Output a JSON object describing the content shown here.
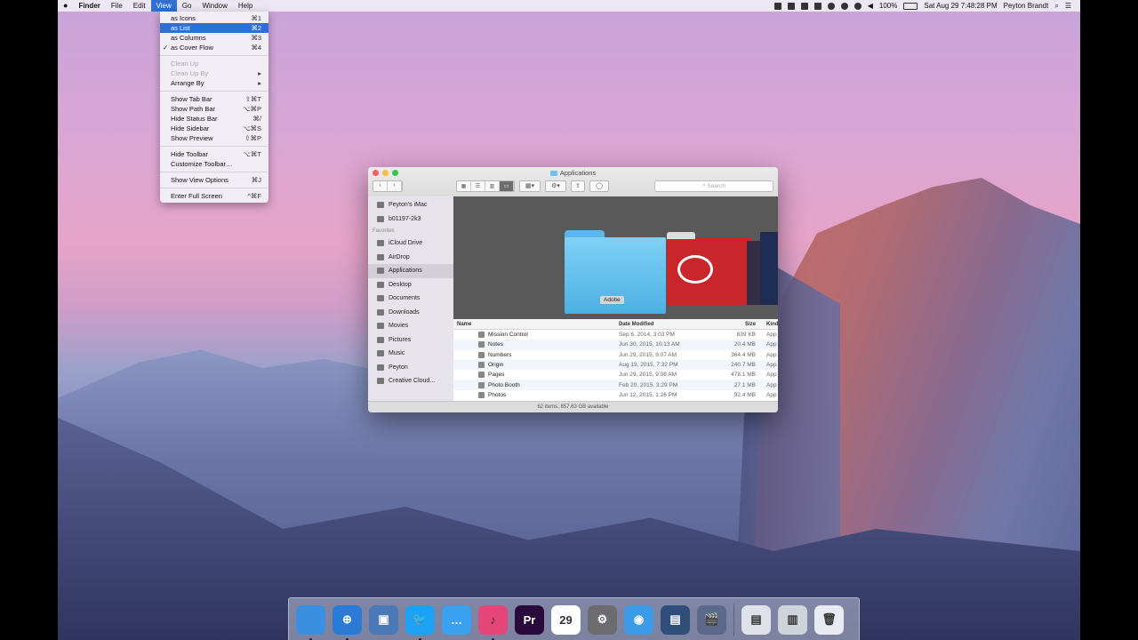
{
  "menubar": {
    "apple": "",
    "items": [
      "Finder",
      "File",
      "Edit",
      "View",
      "Go",
      "Window",
      "Help"
    ],
    "active_index": 3,
    "battery": "100%",
    "clock": "Sat Aug 29  7:48:28 PM",
    "user": "Peyton Brandt"
  },
  "view_menu": {
    "items": [
      {
        "label": "as Icons",
        "shortcut": "⌘1"
      },
      {
        "label": "as List",
        "shortcut": "⌘2",
        "selected": true
      },
      {
        "label": "as Columns",
        "shortcut": "⌘3"
      },
      {
        "label": "as Cover Flow",
        "shortcut": "⌘4",
        "checked": true
      },
      {
        "sep": true
      },
      {
        "label": "Clean Up",
        "disabled": true
      },
      {
        "label": "Clean Up By",
        "disabled": true,
        "submenu": true
      },
      {
        "label": "Arrange By",
        "submenu": true
      },
      {
        "sep": true
      },
      {
        "label": "Show Tab Bar",
        "shortcut": "⇧⌘T"
      },
      {
        "label": "Show Path Bar",
        "shortcut": "⌥⌘P"
      },
      {
        "label": "Hide Status Bar",
        "shortcut": "⌘/"
      },
      {
        "label": "Hide Sidebar",
        "shortcut": "⌥⌘S"
      },
      {
        "label": "Show Preview",
        "shortcut": "⇧⌘P"
      },
      {
        "sep": true
      },
      {
        "label": "Hide Toolbar",
        "shortcut": "⌥⌘T"
      },
      {
        "label": "Customize Toolbar…"
      },
      {
        "sep": true
      },
      {
        "label": "Show View Options",
        "shortcut": "⌘J"
      },
      {
        "sep": true
      },
      {
        "label": "Enter Full Screen",
        "shortcut": "^⌘F"
      }
    ]
  },
  "window": {
    "title": "Applications",
    "search_placeholder": "Search",
    "sidebar": {
      "devices": [
        "Peyton's iMac",
        "b01197-2k3"
      ],
      "favorites_header": "Favorites",
      "favorites": [
        "iCloud Drive",
        "AirDrop",
        "Applications",
        "Desktop",
        "Documents",
        "Downloads",
        "Movies",
        "Pictures",
        "Music",
        "Peyton",
        "Creative Cloud..."
      ],
      "selected": "Applications"
    },
    "cover_label": "Adobe",
    "columns": {
      "name": "Name",
      "date": "Date Modified",
      "size": "Size",
      "kind": "Kind"
    },
    "rows": [
      {
        "name": "Mission Control",
        "date": "Sep 6, 2014, 3:03 PM",
        "size": "839 KB",
        "kind": "App"
      },
      {
        "name": "Notes",
        "date": "Jun 30, 2015, 10:13 AM",
        "size": "20.4 MB",
        "kind": "App"
      },
      {
        "name": "Numbers",
        "date": "Jun 29, 2015, 9:07 AM",
        "size": "364.4 MB",
        "kind": "App"
      },
      {
        "name": "Origin",
        "date": "Aug 19, 2015, 7:32 PM",
        "size": "240.7 MB",
        "kind": "App"
      },
      {
        "name": "Pages",
        "date": "Jun 29, 2015, 9:08 AM",
        "size": "478.1 MB",
        "kind": "App"
      },
      {
        "name": "Photo Booth",
        "date": "Feb 20, 2015, 3:29 PM",
        "size": "27.1 MB",
        "kind": "App"
      },
      {
        "name": "Photos",
        "date": "Jun 12, 2015, 1:26 PM",
        "size": "92.4 MB",
        "kind": "App"
      }
    ],
    "status": "62 items, 857.63 GB available"
  },
  "dock": {
    "apps": [
      {
        "name": "finder-icon",
        "color": "#3a8fe0",
        "glyph": ""
      },
      {
        "name": "safari-icon",
        "color": "#2b7bd6",
        "glyph": "⊕"
      },
      {
        "name": "preview-icon",
        "color": "#4b79b8",
        "glyph": "▣"
      },
      {
        "name": "twitter-icon",
        "color": "#1da1f2",
        "glyph": "🐦"
      },
      {
        "name": "messages-icon",
        "color": "#3aa0f0",
        "glyph": "…"
      },
      {
        "name": "itunes-icon",
        "color": "#e4467a",
        "glyph": "♪"
      },
      {
        "name": "premiere-icon",
        "color": "#2a0a3c",
        "glyph": "Pr"
      },
      {
        "name": "calendar-icon",
        "color": "#ffffff",
        "glyph": "29"
      },
      {
        "name": "system-preferences-icon",
        "color": "#6c6c70",
        "glyph": "⚙"
      },
      {
        "name": "wifi-icon",
        "color": "#3b9be8",
        "glyph": "◉"
      },
      {
        "name": "photos-icon",
        "color": "#2f4f7a",
        "glyph": "▤"
      },
      {
        "name": "imovie-icon",
        "color": "#5b6a8a",
        "glyph": "🎬"
      }
    ],
    "right": [
      {
        "name": "document-icon",
        "color": "#dfe2e8",
        "glyph": "▤"
      },
      {
        "name": "server-icon",
        "color": "#cfd3da",
        "glyph": "▥"
      },
      {
        "name": "trash-icon",
        "color": "#e8ecf2",
        "glyph": "🗑"
      }
    ]
  }
}
